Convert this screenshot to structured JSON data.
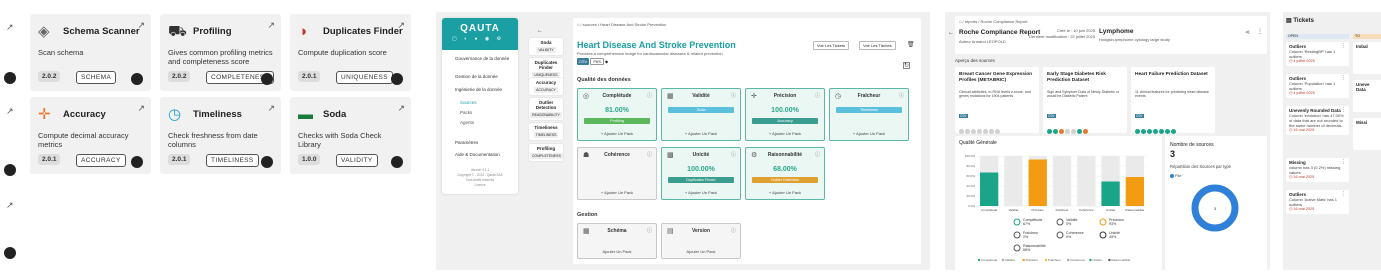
{
  "packs_panel": {
    "cards": [
      {
        "title": "Schema Scanner",
        "desc": "Scan schema",
        "version": "2.0.2",
        "tag": "SCHEMA"
      },
      {
        "title": "Profiling",
        "desc": "Gives common profiling metrics and completeness score",
        "version": "2.0.2",
        "tag": "COMPLETENESS"
      },
      {
        "title": "Duplicates Finder",
        "desc": "Compute duplication score",
        "version": "2.0.1",
        "tag": "UNIQUENESS"
      },
      {
        "title": "Accuracy",
        "desc": "Compute decimal accuracy metrics",
        "version": "2.0.1",
        "tag": "ACCURACY"
      },
      {
        "title": "Timeliness",
        "desc": "Check freshness from date columns",
        "version": "2.0.1",
        "tag": "TIMELINESS"
      },
      {
        "title": "Soda",
        "desc": "Checks with Soda Check Library",
        "version": "1.0.0",
        "tag": "VALIDITY"
      }
    ],
    "icons": {
      "external": "external-link-icon",
      "github": "github-icon"
    }
  },
  "qauta": {
    "logo": "QAUTA",
    "nav": [
      {
        "label": "Gouvernance de la donnée"
      },
      {
        "label": "Gestion de la donnée"
      },
      {
        "label": "Ingénierie de la donnée"
      }
    ],
    "subnav": [
      "Sources",
      "Packs",
      "Agents"
    ],
    "nav2": [
      {
        "label": "Paramètres"
      },
      {
        "label": "Aide & Documentation"
      }
    ],
    "footer": [
      "Version 0.1.1",
      "Copyright © - 2024 - Qauta SAS",
      "Tous droits réservés",
      "Licence"
    ],
    "packs": [
      {
        "name": "Soda",
        "tag": "VALIDITY"
      },
      {
        "name": "Duplicates Finder",
        "tag": "UNIQUENESS"
      },
      {
        "name": "Accuracy",
        "tag": "ACCURACY"
      },
      {
        "name": "Outlier Detection",
        "tag": "REASONABILITY"
      },
      {
        "name": "Timeliness",
        "tag": "TIMELINESS"
      },
      {
        "name": "Profiling",
        "tag": "COMPLETENESS"
      }
    ],
    "breadcrumb": "⌂ / sources / Heart Disease And Stroke Prevention",
    "title": "Heart Disease And Stroke Prevention",
    "subtitle": "Provides a comprehensive image for cardiovascular diseases & related prevention",
    "chips": [
      "CSV",
      "PIIS"
    ],
    "btn_tickets": "Voir Les Tickets",
    "btn_taches": "Voir Les Tâches",
    "section_quality": "Qualité des données",
    "section_gestion": "Gestion",
    "add_label": "Ajouter Un Pack",
    "quality": [
      {
        "name": "Complétude",
        "score": "81.00%",
        "pack": "Profiling",
        "color": "#5cb85c"
      },
      {
        "name": "Validité",
        "score": "",
        "pack": "Soda",
        "color": "#5bc0de"
      },
      {
        "name": "Précision",
        "score": "100.00%",
        "pack": "Accuracy",
        "color": "#3a9d8f"
      },
      {
        "name": "Fraîcheur",
        "score": "",
        "pack": "Timeliness",
        "color": "#5bc0de"
      },
      {
        "name": "Cohérence",
        "score": "",
        "pack": "",
        "color": ""
      },
      {
        "name": "Unicité",
        "score": "100.00%",
        "pack": "Duplicates Finder",
        "color": "#3a9d8f"
      },
      {
        "name": "Raisonnabilité",
        "score": "68.00%",
        "pack": "Outlier Detection",
        "color": "#e0a030"
      }
    ],
    "gestion": [
      {
        "name": "Schéma"
      },
      {
        "name": "Version"
      }
    ]
  },
  "roche": {
    "breadcrumb": "⌂ / reports / Roche Compliance Report",
    "title": "Roche Compliance Report",
    "author_label": "Auteur",
    "author": "Armand LEOPOLD",
    "created_label": "Créé le :",
    "created": "10 juin 2025",
    "modified_label": "Dernière modification :",
    "modified": "22 juillet 2025",
    "lymph_title": "Lymphome",
    "lymph_sub": "Hodgkin-lymphome cytology large study",
    "sources_label": "Aperçu des sources",
    "sources": [
      {
        "title": "Breast Cancer Gene Expression Profiles (METABRIC)",
        "desc": "Clinical attributes, m-RNA levels z-score, and genes mutations for 1904 patients"
      },
      {
        "title": "Early Stage Diabetes Risk Prediction Dataset",
        "desc": "Sign and Symptom Data of Newly Diabetic or would be Diabetic Patient"
      },
      {
        "title": "Heart Failure Prediction Dataset",
        "desc": "11 clinical features for predicting heart disease events"
      }
    ],
    "quality_label": "Qualité Générale",
    "nb_label": "Nombre de sources",
    "nb_value": "3",
    "rep_label": "Répartition des Sources par type",
    "rep_legend": "File",
    "donut_value": "3",
    "bars": {
      "labels": [
        "Complétude",
        "Validité",
        "Précision",
        "Fraîcheur",
        "Cohérence",
        "Unicité",
        "Raisonnabilité"
      ],
      "values": [
        67,
        0,
        93,
        0,
        0,
        49,
        58
      ]
    },
    "yticks": [
      "100.0%",
      "80.0%",
      "60.0%",
      "40.0%",
      "20.0%",
      "0.0%"
    ],
    "metrics": [
      {
        "name": "Complétude",
        "val": "67%"
      },
      {
        "name": "Validité",
        "val": "0%"
      },
      {
        "name": "Précision",
        "val": "93%"
      },
      {
        "name": "Fraîcheur",
        "val": "0%"
      },
      {
        "name": "Cohérence",
        "val": "0%"
      },
      {
        "name": "Unicité",
        "val": "49%"
      },
      {
        "name": "Raisonnabilité",
        "val": "58%"
      }
    ],
    "legend": [
      "Complétude",
      "Validité",
      "Précision",
      "Fraîcheur",
      "Cohérence",
      "Unicité",
      "Raisonnabilité"
    ]
  },
  "tickets": {
    "title": "Tickets",
    "col_open": "OPEN",
    "col_next": "TO",
    "items": [
      {
        "title": "Outliers",
        "desc": "Column 'RestingBP' has 1 outliers",
        "date": "4 juillet 2025"
      },
      {
        "title": "Outliers",
        "desc": "Column 'Population' has 1 outliers",
        "date": "4 juillet 2025"
      },
      {
        "title": "Unevenly Rounded Data",
        "desc": "Column 'evolution' has 47.00% of data that are not rounded to the same number of decimals.",
        "date": "16 mai 2025"
      },
      {
        "title": "Missing",
        "desc": "column has 3 (0.2%) missing values",
        "date": "16 mai 2025"
      },
      {
        "title": "Outliers",
        "desc": "Column 'Active Mats' has 1 outliers",
        "date": "16 mai 2025"
      }
    ],
    "right_items": [
      "Imbal",
      "Uneve Data",
      "Missi"
    ]
  }
}
